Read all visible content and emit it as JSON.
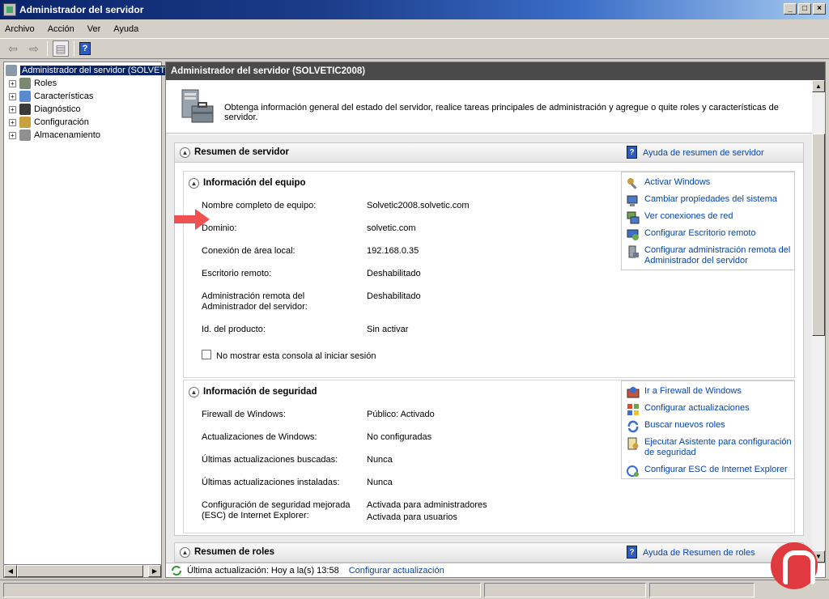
{
  "window": {
    "title": "Administrador del servidor"
  },
  "menu": [
    "Archivo",
    "Acción",
    "Ver",
    "Ayuda"
  ],
  "tree": {
    "root": "Administrador del servidor (SOLVET",
    "items": [
      "Roles",
      "Características",
      "Diagnóstico",
      "Configuración",
      "Almacenamiento"
    ]
  },
  "right": {
    "header": "Administrador del servidor (SOLVETIC2008)",
    "intro": "Obtenga información general del estado del servidor, realice tareas principales de administración y agregue o quite roles y características de servidor."
  },
  "summary": {
    "title": "Resumen de servidor",
    "help_link": "Ayuda de resumen de servidor",
    "equipo": {
      "title": "Información del equipo",
      "rows": [
        {
          "label": "Nombre completo de equipo:",
          "value": "Solvetic2008.solvetic.com"
        },
        {
          "label": "Dominio:",
          "value": "solvetic.com"
        },
        {
          "label": "Conexión de área local:",
          "value": "192.168.0.35"
        },
        {
          "label": "Escritorio remoto:",
          "value": "Deshabilitado"
        },
        {
          "label": "Administración remota del Administrador del servidor:",
          "value": "Deshabilitado"
        },
        {
          "label": "Id. del producto:",
          "value": "Sin activar"
        }
      ],
      "checkbox_label": "No mostrar esta consola al iniciar sesión",
      "tasks": [
        "Activar Windows",
        "Cambiar propiedades del sistema",
        "Ver conexiones de red",
        "Configurar Escritorio remoto",
        "Configurar administración remota del Administrador del servidor"
      ]
    },
    "seguridad": {
      "title": "Información de seguridad",
      "rows": [
        {
          "label": "Firewall de Windows:",
          "value": "Público: Activado"
        },
        {
          "label": "Actualizaciones de Windows:",
          "value": "No configuradas"
        },
        {
          "label": "Últimas actualizaciones buscadas:",
          "value": "Nunca"
        },
        {
          "label": "Últimas actualizaciones instaladas:",
          "value": "Nunca"
        },
        {
          "label": "Configuración de seguridad mejorada (ESC) de Internet Explorer:",
          "value": "Activada para administradores",
          "value2": "Activada para usuarios"
        }
      ],
      "tasks": [
        "Ir a Firewall de Windows",
        "Configurar actualizaciones",
        "Buscar nuevos roles",
        "Ejecutar Asistente para configuración de seguridad",
        "Configurar ESC de Internet Explorer"
      ]
    }
  },
  "roles": {
    "title": "Resumen de roles",
    "help_link": "Ayuda de Resumen de roles"
  },
  "status": {
    "text": "Última actualización: Hoy a la(s) 13:58",
    "link": "Configurar actualización"
  },
  "colors": {
    "title_bar": "#0a246a",
    "link": "#0645ad",
    "header_bar": "#4a4a4a",
    "arrow": "#f05050"
  }
}
